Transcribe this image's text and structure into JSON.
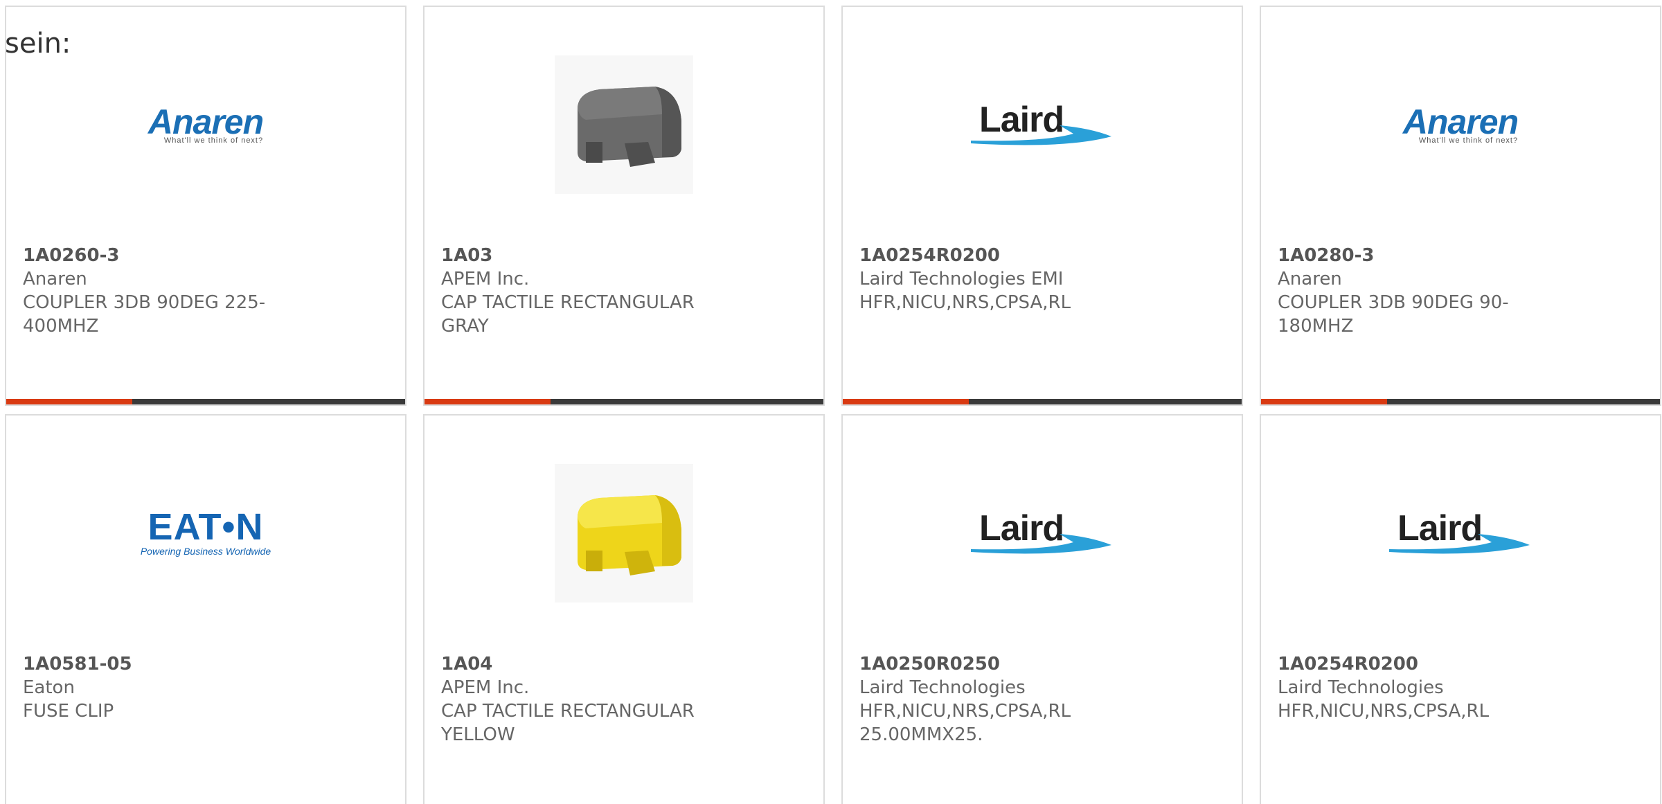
{
  "intro_text": "sein:",
  "cards": [
    {
      "part_number": "1A0260-3",
      "manufacturer": "Anaren",
      "description": "COUPLER 3DB 90DEG 225-400MHZ",
      "image": "anaren-logo",
      "logo_tagline": "What'll we think of next?"
    },
    {
      "part_number": "1A03",
      "manufacturer": "APEM Inc.",
      "description": "CAP TACTILE RECTANGULAR GRAY",
      "image": "gray-tactile-cap-photo"
    },
    {
      "part_number": "1A0254R0200",
      "manufacturer": "Laird Technologies EMI",
      "description": "HFR,NICU,NRS,CPSA,RL",
      "image": "laird-logo"
    },
    {
      "part_number": "1A0280-3",
      "manufacturer": "Anaren",
      "description": "COUPLER 3DB 90DEG 90-180MHZ",
      "image": "anaren-logo",
      "logo_tagline": "What'll we think of next?"
    },
    {
      "part_number": "1A0581-05",
      "manufacturer": "Eaton",
      "description": "FUSE CLIP",
      "image": "eaton-logo",
      "logo_tagline": "Powering Business Worldwide"
    },
    {
      "part_number": "1A04",
      "manufacturer": "APEM Inc.",
      "description": "CAP TACTILE RECTANGULAR YELLOW",
      "image": "yellow-tactile-cap-photo"
    },
    {
      "part_number": "1A0250R0250",
      "manufacturer": "Laird Technologies",
      "description": "HFR,NICU,NRS,CPSA,RL 25.00MMX25.",
      "image": "laird-logo"
    },
    {
      "part_number": "1A0254R0200",
      "manufacturer": "Laird Technologies",
      "description": "HFR,NICU,NRS,CPSA,RL",
      "image": "laird-logo"
    }
  ],
  "logos": {
    "anaren_word": "Anaren",
    "laird_word": "Laird",
    "eaton_word": "EAT•N"
  },
  "colors": {
    "accent_bar": "#d93a12",
    "bar_dark": "#3a3a3a",
    "anaren_blue": "#1b6fb5",
    "laird_swoosh": "#2aa0d8",
    "eaton_blue": "#1565b3",
    "gray_cap": "#606060",
    "yellow_cap": "#f2dc23"
  }
}
